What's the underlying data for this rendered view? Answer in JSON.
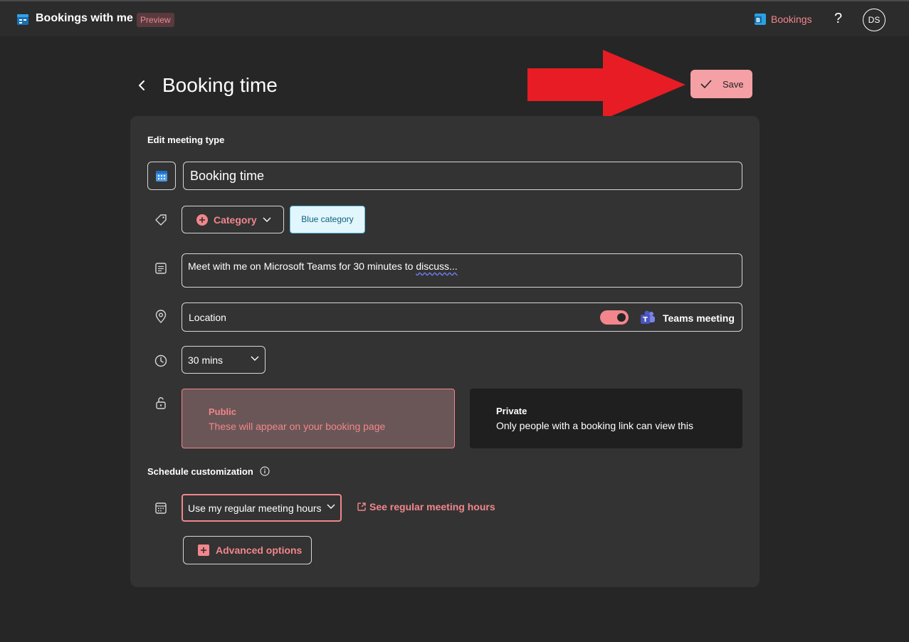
{
  "topbar": {
    "app_title": "Bookings with me",
    "preview_badge": "Preview",
    "bookings_link": "Bookings",
    "help": "?",
    "avatar_initials": "DS"
  },
  "page": {
    "title": "Booking time",
    "save_label": "Save"
  },
  "form": {
    "section_title": "Edit meeting type",
    "meeting_title": "Booking time",
    "category_label": "Category",
    "category_tag": "Blue category",
    "description_prefix": "Meet with me on Microsoft Teams for 30 minutes to ",
    "description_misspelled": "discuss...",
    "location_label": "Location",
    "teams_label": "Teams meeting",
    "teams_toggle_on": true,
    "duration": "30 mins",
    "public_title": "Public",
    "public_desc": "These will appear on your booking page",
    "private_title": "Private",
    "private_desc": "Only people with a booking link can view this"
  },
  "schedule": {
    "section_title": "Schedule customization",
    "hours_option": "Use my regular meeting hours",
    "see_hours_link": "See regular meeting hours",
    "advanced_label": "Advanced options"
  },
  "colors": {
    "accent": "#f2868c",
    "save_bg": "#f4a0a5",
    "arrow": "#e81c24",
    "blue_tag_bg": "#e1f6fd",
    "card_bg": "#333333",
    "page_bg": "#262626"
  }
}
